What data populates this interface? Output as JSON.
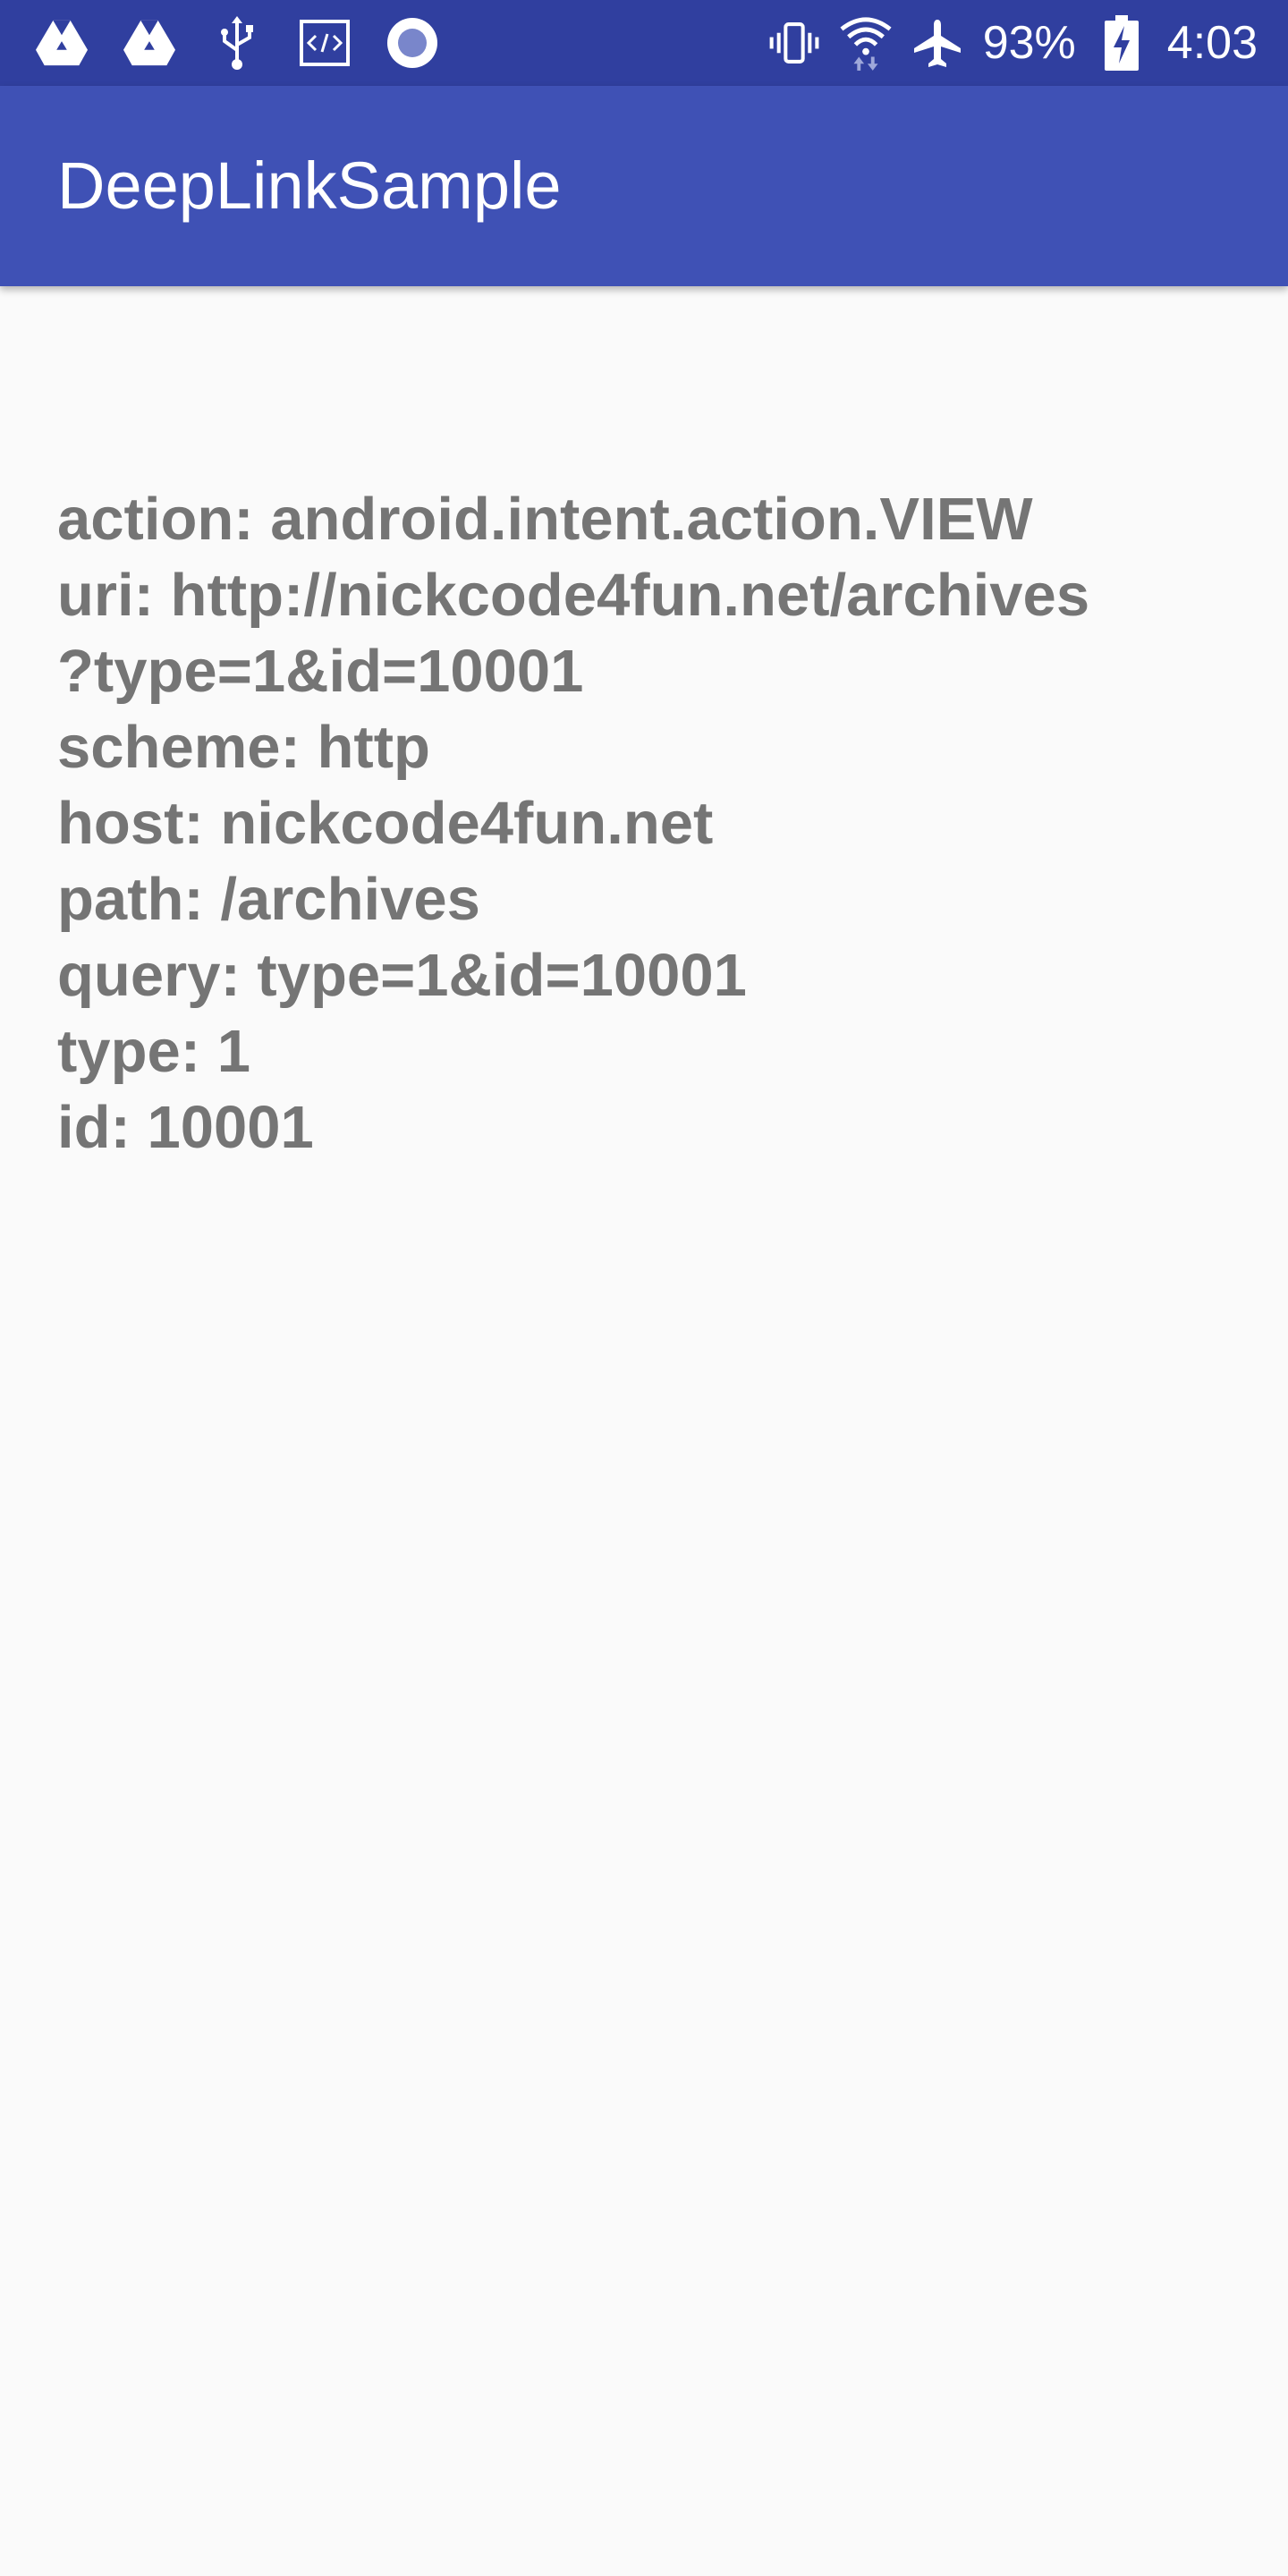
{
  "status_bar": {
    "left_icons": [
      "drive-icon",
      "drive-icon",
      "usb-icon",
      "code-icon",
      "record-icon"
    ],
    "right_icons": [
      "vibrate-icon",
      "wifi-icon",
      "airplane-icon",
      "battery-charging-icon"
    ],
    "battery": "93%",
    "time": "4:03",
    "colors": {
      "background": "#303f9f",
      "foreground": "#ffffff"
    }
  },
  "app_bar": {
    "title": "DeepLinkSample",
    "color": "#3f51b5"
  },
  "content": {
    "lines": [
      "action: android.intent.action.VIEW",
      "uri: http://nickcode4fun.net/archives",
      "?type=1&id=10001",
      "scheme: http",
      "host: nickcode4fun.net",
      "path: /archives",
      "query: type=1&id=10001",
      "type: 1",
      "id: 10001"
    ],
    "text_color": "#757575",
    "background": "#fafafa"
  }
}
